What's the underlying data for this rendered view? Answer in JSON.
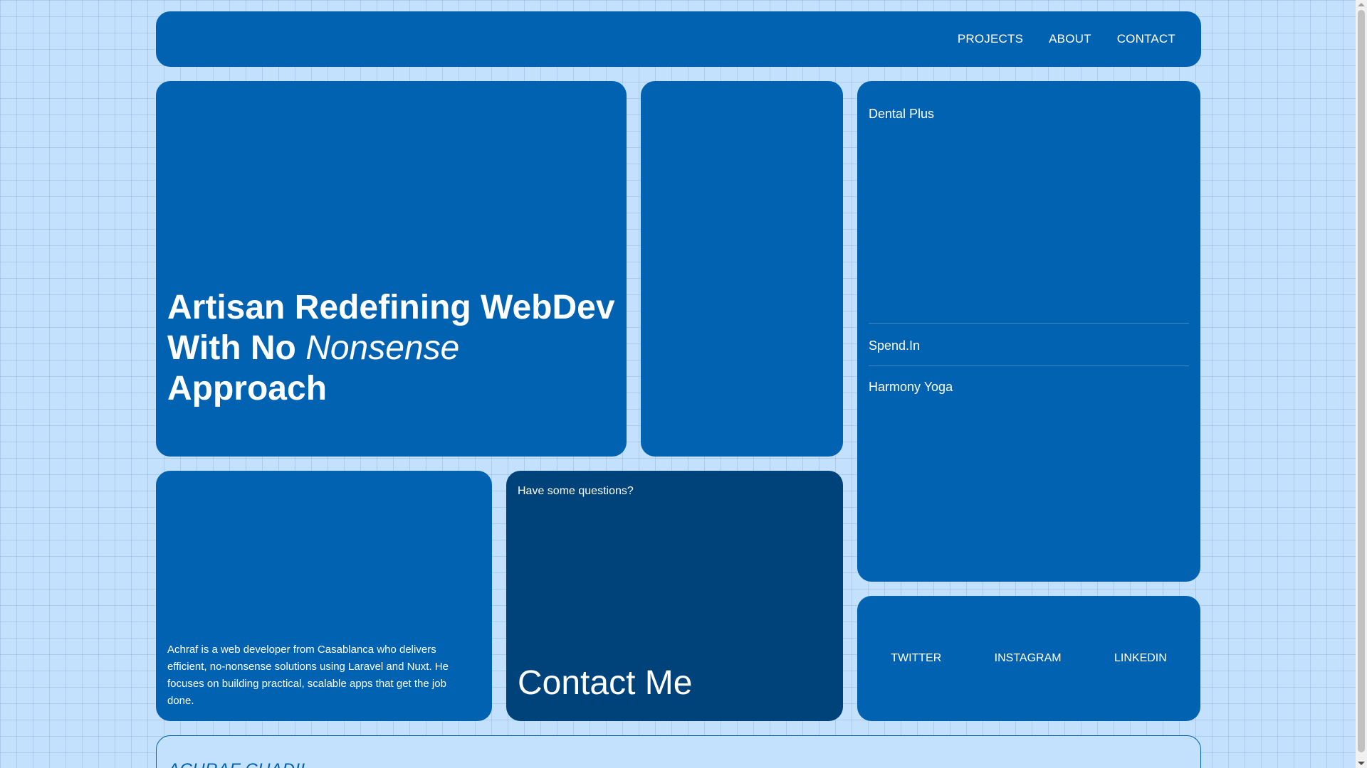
{
  "nav": {
    "items": [
      "PROJECTS",
      "ABOUT",
      "CONTACT"
    ]
  },
  "hero": {
    "title_part1": "Artisan Redefining WebDev With No ",
    "title_em": "Nonsense",
    "title_part2": " Approach"
  },
  "projects": {
    "items": [
      "Dental Plus",
      "Spend.In",
      "Harmony Yoga"
    ]
  },
  "about": {
    "text": "Achraf is a web developer from Casablanca who delivers efficient, no-nonsense solutions using Laravel and Nuxt. He focuses on building practical, scalable apps that get the job done."
  },
  "contact": {
    "question": "Have some questions?",
    "title": "Contact Me"
  },
  "socials": {
    "items": [
      "TWITTER",
      "INSTAGRAM",
      "LINKEDIN"
    ]
  },
  "footer": {
    "name": "ACHRAF CHADIL"
  },
  "colors": {
    "background": "#c3e1fc",
    "card": "#0062b1",
    "contact_card": "#00437b"
  }
}
